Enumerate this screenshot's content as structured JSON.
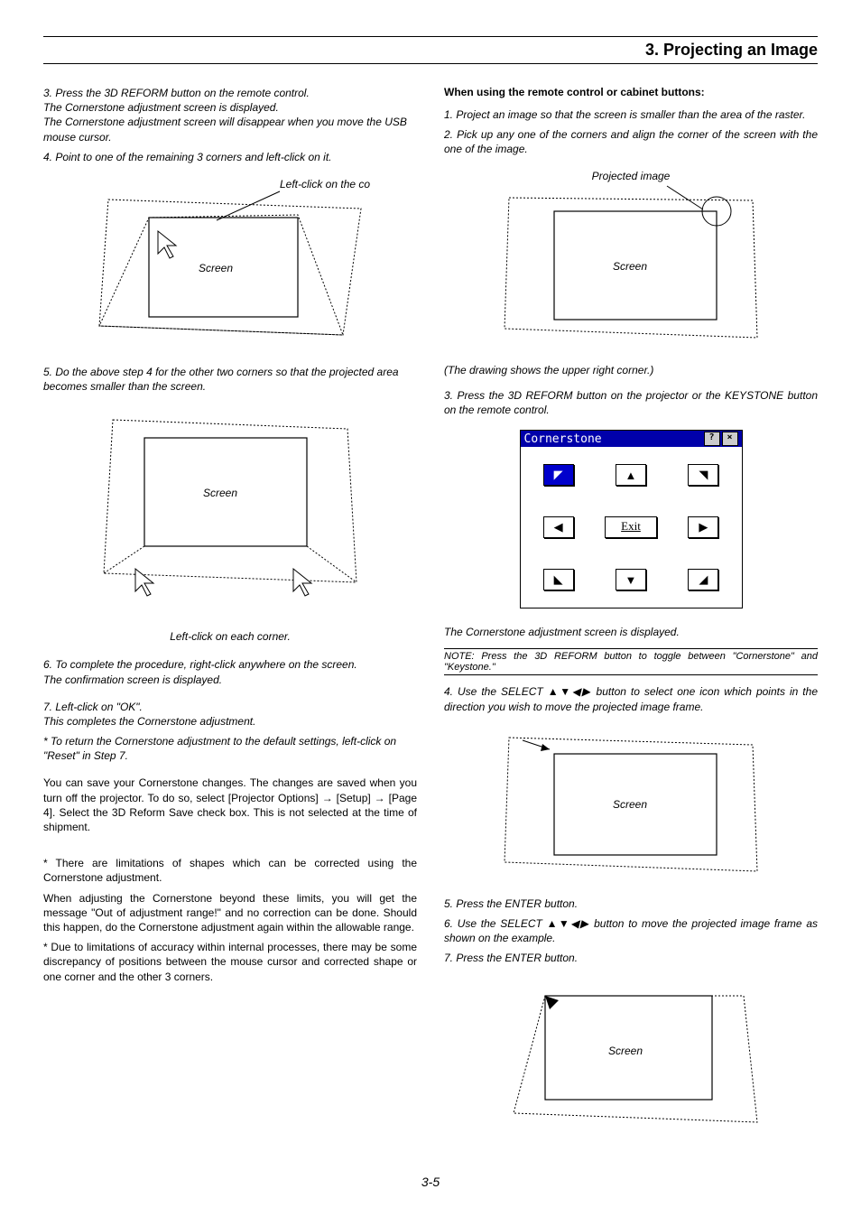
{
  "chapter": "3. Projecting an Image",
  "left": {
    "step3": {
      "line1": "3. Press the 3D REFORM button on the remote control.",
      "line2": "The Cornerstone adjustment screen is displayed.",
      "line3": "The Cornerstone adjustment screen will disappear when you move the USB mouse cursor."
    },
    "step4": "4. Point to one of the remaining 3 corners and left-click on it.",
    "fig1": {
      "annot": "Left-click on the corner.",
      "screen": "Screen"
    },
    "step5": "5. Do the above step 4 for the other two corners so that the projected area becomes smaller than the screen.",
    "fig2": {
      "screen": "Screen",
      "caption": "Left-click on each corner."
    },
    "step6": {
      "line1": "6. To complete the procedure, right-click anywhere on the screen.",
      "line2": "The confirmation screen is displayed."
    },
    "step7": {
      "line1": "7. Left-click on \"OK\".",
      "line2": "This completes the Cornerstone adjustment."
    },
    "star": "* To return the Cornerstone adjustment to the default settings, left-click on \"Reset\" in Step 7.",
    "para1": "You can save your Cornerstone changes. The changes are saved when you turn off the projector. To do so, select [Projector Options] → [Setup] → [Page 4]. Select the 3D Reform Save check box. This is not selected at the time of shipment.",
    "para2": "* There are limitations of shapes which can be corrected using the Cornerstone adjustment.",
    "para3": "When adjusting the Cornerstone beyond these limits, you will get the message \"Out of adjustment range!\" and no correction can be done. Should this happen, do the Cornerstone adjustment again within the allowable range.",
    "para4": "* Due to limitations of accuracy within internal processes, there may be some discrepancy of positions between the mouse cursor and corrected shape or one corner and the other 3 corners."
  },
  "right": {
    "heading": "When using the remote control or cabinet buttons:",
    "step1": "1. Project an image so that the screen is smaller than the area of the raster.",
    "step2": "2. Pick up any one of the corners and align the corner of the screen with the one of the image.",
    "fig3": {
      "annot": "Projected image",
      "screen": "Screen",
      "caption": "(The drawing shows the upper right corner.)"
    },
    "step3": "3. Press the 3D REFORM button on the projector or the KEYSTONE button on the remote control.",
    "ui": {
      "title": "Cornerstone",
      "exit": "Exit"
    },
    "ui_caption": "The Cornerstone adjustment screen is displayed.",
    "note": "NOTE: Press the 3D REFORM button to toggle between \"Cornerstone\" and \"Keystone.\"",
    "step4": "4. Use the SELECT ▲▼◀▶ button to select one icon which points in the direction you wish to move the projected image frame.",
    "fig4": {
      "screen": "Screen"
    },
    "step5": "5. Press the ENTER button.",
    "step6": "6. Use the SELECT ▲▼◀▶ button to move the projected image frame as shown on the example.",
    "step7": "7. Press the ENTER button.",
    "fig5": {
      "screen": "Screen"
    }
  },
  "page_num": "3-5"
}
